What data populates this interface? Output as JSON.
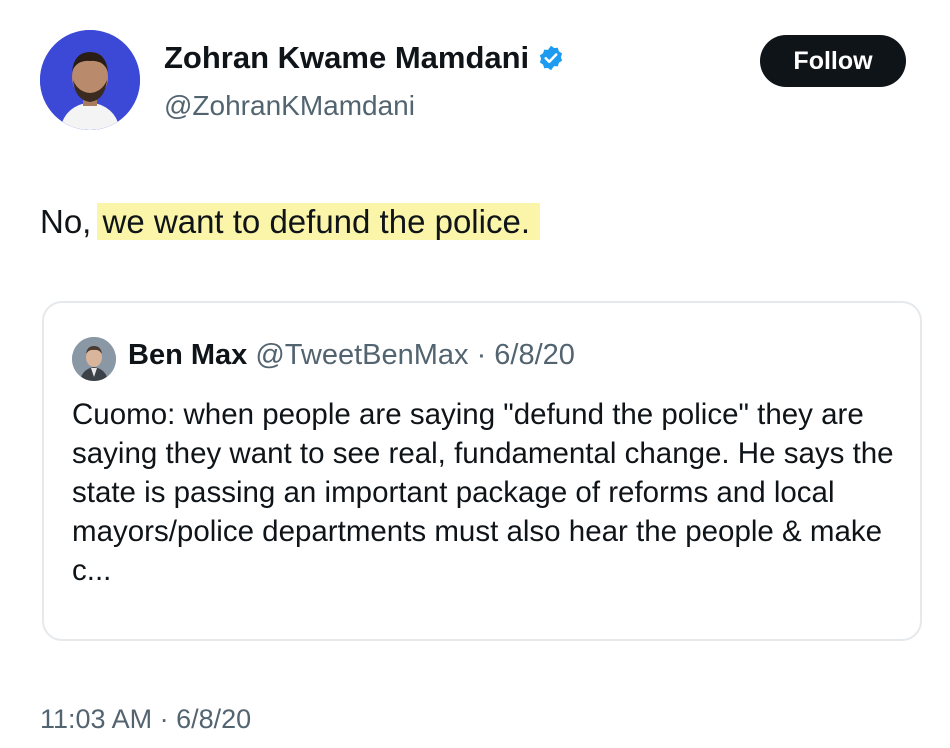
{
  "tweet": {
    "author": {
      "name": "Zohran Kwame Mamdani",
      "handle": "@ZohranKMamdani",
      "verified_icon": "verified-badge-icon",
      "avatar_bg": "#3b49d6"
    },
    "follow_label": "Follow",
    "text_prefix": "No, ",
    "text_highlight": "we want to defund the police.",
    "highlight_color": "#faf5a8",
    "timestamp": "11:03 AM · 6/8/20"
  },
  "quote": {
    "name": "Ben Max",
    "handle": "@TweetBenMax",
    "date": "· 6/8/20",
    "text": "Cuomo: when people are saying \"defund the police\" they are saying they want to see real, fundamental change. He says the state is passing an important package of reforms and local mayors/police departments must also hear the people & make c..."
  },
  "colors": {
    "text": "#0f1419",
    "secondary_text": "#536471",
    "verified": "#1d9bf0",
    "follow_bg": "#0f1419"
  }
}
